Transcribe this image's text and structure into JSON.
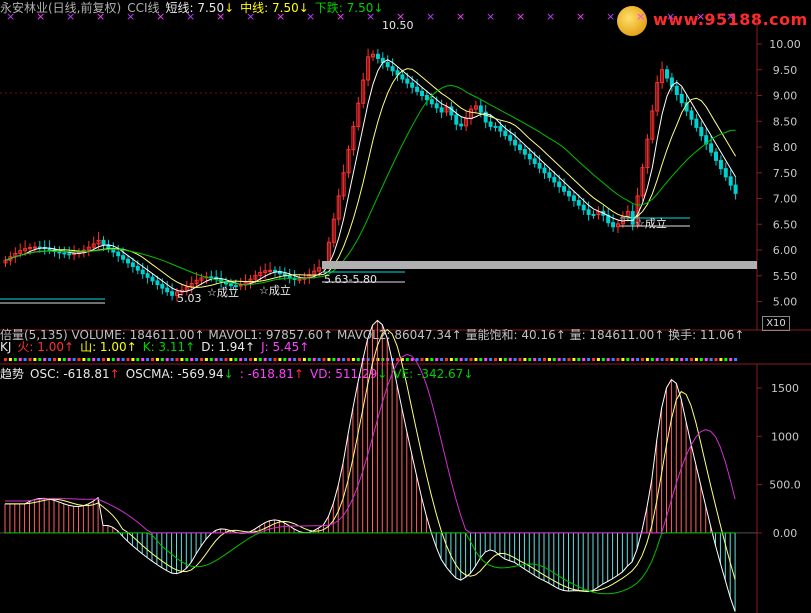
{
  "title_bar": {
    "stock_name": "永安林业(日线,前复权)",
    "indicator": "CCI线",
    "short_label": "短线: 7.50",
    "short_arrow": "↓",
    "mid_label": "中线: 7.50",
    "mid_arrow": "↓",
    "down_label": "下跌: 7.50",
    "down_arrow": "↓"
  },
  "watermark": {
    "text": "www.95188.com"
  },
  "price_axis": {
    "ticks": [
      "10.00",
      "9.50",
      "9.00",
      "8.50",
      "8.00",
      "7.50",
      "7.00",
      "6.50",
      "6.00",
      "5.50",
      "5.00"
    ]
  },
  "annotations": {
    "high": "10.50",
    "low": "5.03",
    "range": "5.63-5.80",
    "signal1": "☆成立",
    "signal2": "☆成立",
    "signal3": "☆成立"
  },
  "x10_button": "X10",
  "volume_row": {
    "text": "倍量(5,135) VOLUME: 184611.00↑ MAVOL1: 97857.60↑ MAVOL2: 86047.34↑ 量能饱和: 40.16↑ 量: 184611.00↑ 换手: 11.06↑"
  },
  "kj_row": {
    "name": "KJ",
    "fire": "火: 1.00",
    "fire_arrow": "↑",
    "mountain": "山: 1.00",
    "mountain_arrow": "↑",
    "k": "K: 3.11",
    "k_arrow": "↑",
    "d": "D: 1.94",
    "d_arrow": "↑",
    "j": "J: 5.45",
    "j_arrow": "↑"
  },
  "trend_row": {
    "name": "趋势",
    "osc": "OSC: -618.81",
    "osc_arrow": "↑",
    "oscma": "OSCMA: -569.94",
    "oscma_arrow": "↓",
    "unnamed": ": -618.81",
    "unnamed_arrow": "↑",
    "vd": "VD: 511.29",
    "vd_arrow": "↓",
    "ve": "VE: -342.67",
    "ve_arrow": "↓"
  },
  "osc_axis": {
    "ticks": [
      "1500",
      "1000",
      "500.0",
      "0.00"
    ]
  },
  "colors": {
    "up": "#ff3030",
    "down": "#00d0d0",
    "ma_white": "#ffffff",
    "ma_yellow": "#ffff80",
    "ma_green": "#00c000",
    "magenta": "#d030d0"
  }
}
